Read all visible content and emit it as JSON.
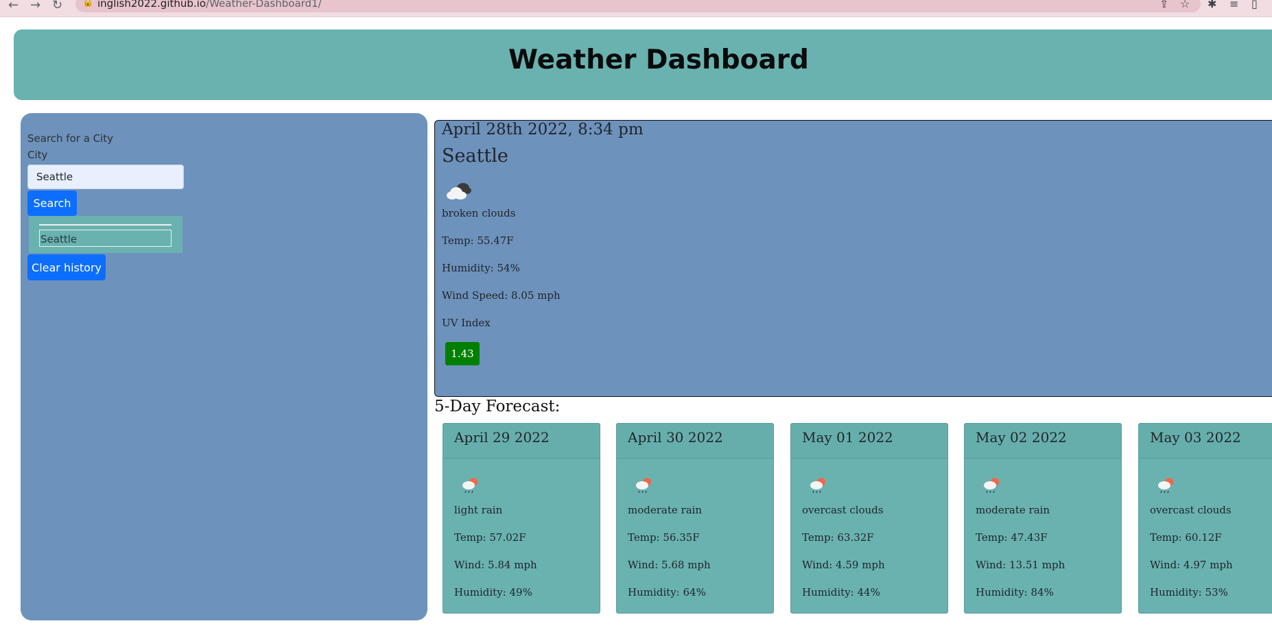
{
  "browser": {
    "url_host": "inglish2022.github.io",
    "url_path": "/Weather-Dashboard1/"
  },
  "header": {
    "title": "Weather Dashboard"
  },
  "sidebar": {
    "search_label": "Search for a City",
    "city_label": "City",
    "city_value": "Seattle",
    "search_button": "Search",
    "history": [
      "Seattle"
    ],
    "clear_button": "Clear history"
  },
  "current": {
    "date": "April 28th 2022, 8:34 pm",
    "city": "Seattle",
    "icon": "broken-clouds-icon",
    "description": "broken clouds",
    "temp": "Temp: 55.47F",
    "humidity": "Humidity: 54%",
    "wind": "Wind Speed: 8.05 mph",
    "uv_label": "UV Index",
    "uv_value": "1.43",
    "uv_color": "#008000"
  },
  "forecast": {
    "title": "5-Day Forecast:",
    "days": [
      {
        "date": "April 29 2022",
        "icon": "rain-icon",
        "description": "light rain",
        "temp": "Temp: 57.02F",
        "wind": "Wind: 5.84 mph",
        "humidity": "Humidity: 49%"
      },
      {
        "date": "April 30 2022",
        "icon": "rain-icon",
        "description": "moderate rain",
        "temp": "Temp: 56.35F",
        "wind": "Wind: 5.68 mph",
        "humidity": "Humidity: 64%"
      },
      {
        "date": "May 01 2022",
        "icon": "rain-icon",
        "description": "overcast clouds",
        "temp": "Temp: 63.32F",
        "wind": "Wind: 4.59 mph",
        "humidity": "Humidity: 44%"
      },
      {
        "date": "May 02 2022",
        "icon": "rain-icon",
        "description": "moderate rain",
        "temp": "Temp: 47.43F",
        "wind": "Wind: 13.51 mph",
        "humidity": "Humidity: 84%"
      },
      {
        "date": "May 03 2022",
        "icon": "rain-icon",
        "description": "overcast clouds",
        "temp": "Temp: 60.12F",
        "wind": "Wind: 4.97 mph",
        "humidity": "Humidity: 53%"
      }
    ]
  },
  "colors": {
    "header_bg": "#69b2b0",
    "panel_bg": "#6d92bc",
    "button_bg": "#0d6efd",
    "card_bg": "#69b2b0"
  }
}
